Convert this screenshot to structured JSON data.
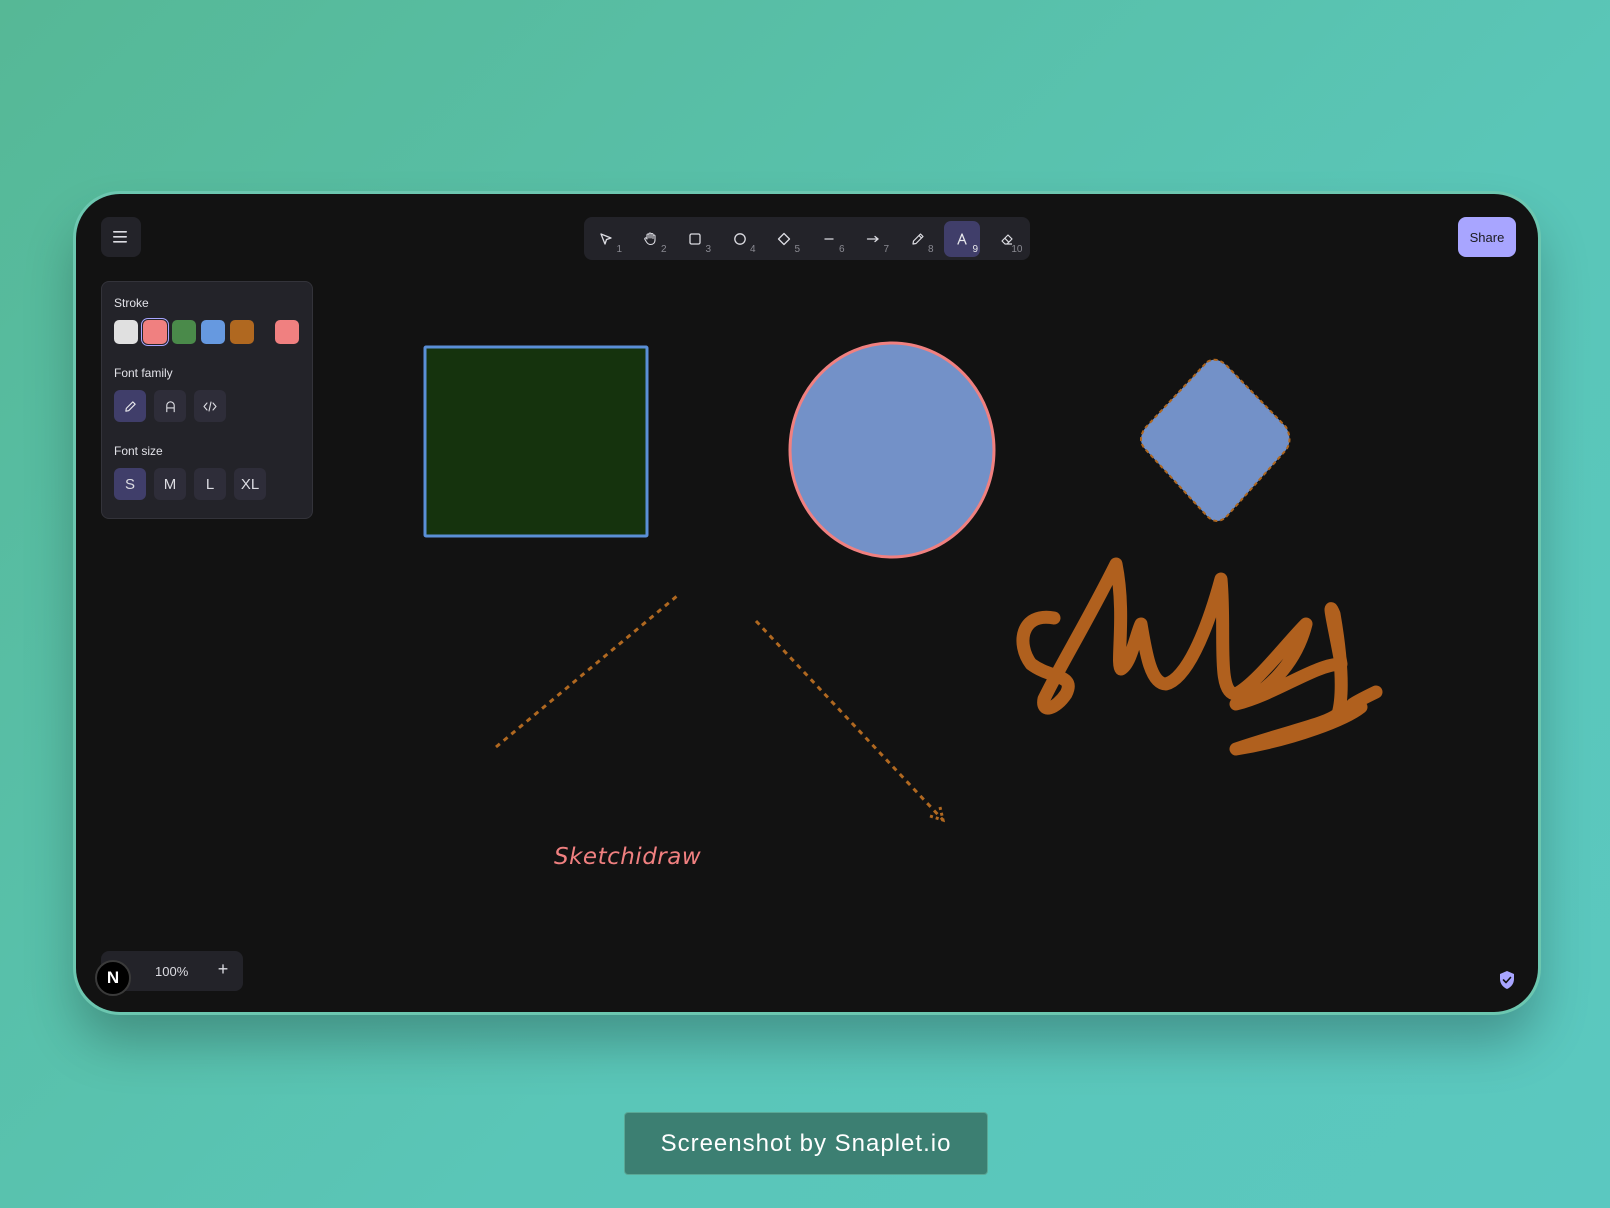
{
  "toolbar": {
    "tools": [
      {
        "name": "selection",
        "shortcut": "1"
      },
      {
        "name": "hand",
        "shortcut": "2"
      },
      {
        "name": "rectangle",
        "shortcut": "3"
      },
      {
        "name": "ellipse",
        "shortcut": "4"
      },
      {
        "name": "diamond",
        "shortcut": "5"
      },
      {
        "name": "line",
        "shortcut": "6"
      },
      {
        "name": "arrow",
        "shortcut": "7"
      },
      {
        "name": "freedraw",
        "shortcut": "8"
      },
      {
        "name": "text",
        "shortcut": "9",
        "active": true
      },
      {
        "name": "eraser",
        "shortcut": "10"
      }
    ]
  },
  "share_label": "Share",
  "properties": {
    "stroke_label": "Stroke",
    "stroke_colors": [
      "#e0e0e0",
      "#f08080",
      "#4a8a4a",
      "#6699e0",
      "#b06820"
    ],
    "selected_stroke": "#f08080",
    "font_family_label": "Font family",
    "font_size_label": "Font size",
    "font_sizes": [
      "S",
      "M",
      "L",
      "XL"
    ],
    "selected_font_size": "S"
  },
  "zoom": {
    "value": "100%",
    "plus": "+"
  },
  "logo_letter": "N",
  "canvas": {
    "text_element": "Sketchidraw",
    "colors": {
      "rect_fill": "#15330d",
      "rect_stroke": "#5a8fd6",
      "ellipse_fill": "#7391c8",
      "ellipse_stroke": "#f08080",
      "diamond_fill": "#7391c8",
      "diamond_stroke": "#b06820",
      "line_stroke": "#b06820",
      "freedraw_stroke": "#b0601e"
    }
  },
  "caption": "Screenshot by Snaplet.io"
}
